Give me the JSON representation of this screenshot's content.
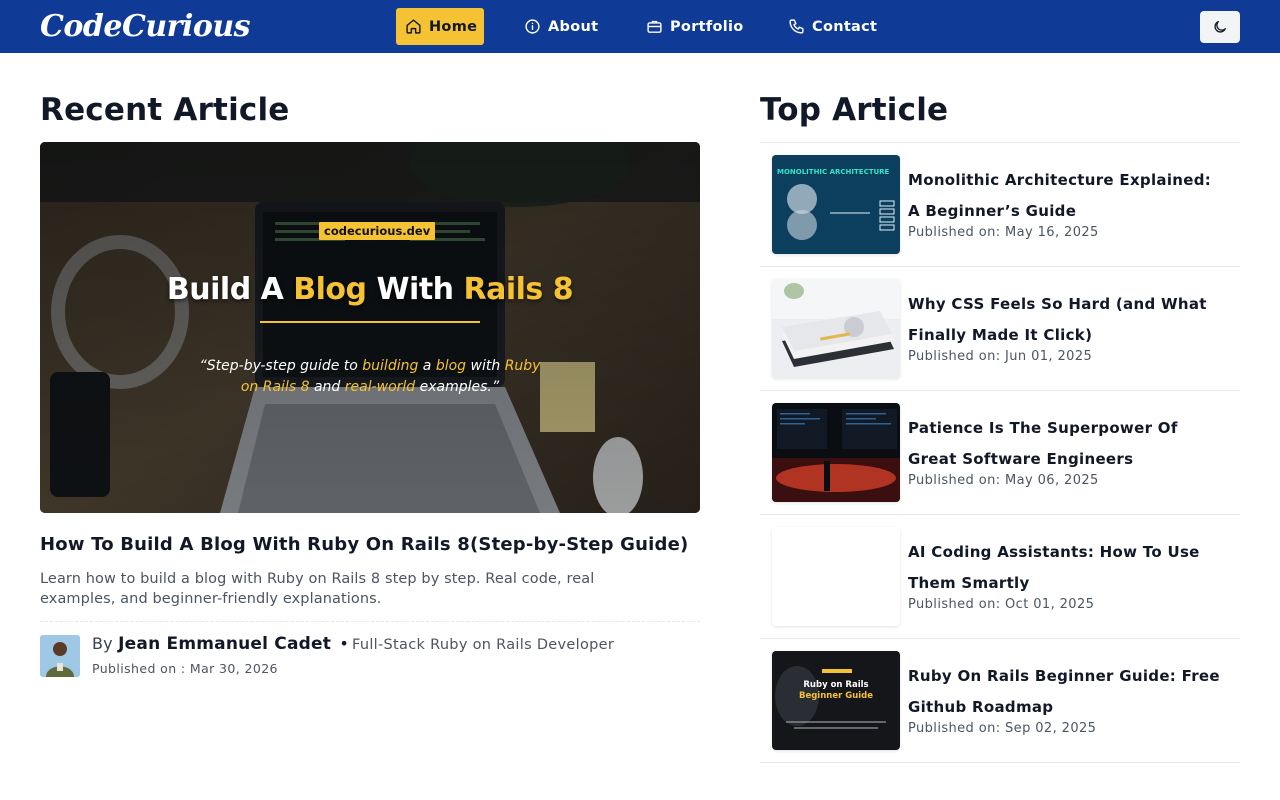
{
  "brand": "CodeCurious",
  "nav": {
    "items": [
      {
        "label": "Home",
        "icon": "home-icon"
      },
      {
        "label": "About",
        "icon": "info-icon"
      },
      {
        "label": "Portfolio",
        "icon": "briefcase-icon"
      },
      {
        "label": "Contact",
        "icon": "phone-icon"
      }
    ],
    "active": "Home",
    "theme_toggle_icon": "moon-icon"
  },
  "colors": {
    "navbar": "#0f3a96",
    "accent": "#f5c233",
    "text": "#111827",
    "muted": "#4b5563"
  },
  "recent": {
    "heading": "Recent Article",
    "image": {
      "site": "codecurious.dev",
      "headline_pre": "Build A ",
      "headline_hl1": "Blog",
      "headline_mid": " With ",
      "headline_hl2": "Rails 8",
      "sub_1": "“Step-by-step",
      "sub_2": " guide to ",
      "sub_3": "building",
      "sub_4": " a ",
      "sub_5": "blog",
      "sub_6": " with ",
      "sub_7": "Ruby on Rails 8",
      "sub_8": " and ",
      "sub_9": "real-world",
      "sub_10": " examples.”"
    },
    "title": "How To Build A Blog With Ruby On Rails 8(Step-by-Step Guide)",
    "description": "Learn how to build a blog with Ruby on Rails 8 step by step. Real code, real examples, and beginner-friendly explanations.",
    "author": {
      "prefix": "By",
      "name": "Jean Emmanuel Cadet",
      "separator": "•",
      "role": "Full-Stack Ruby on Rails Developer",
      "published": "Published on : Mar 30, 2026"
    }
  },
  "top": {
    "heading": "Top Article",
    "items": [
      {
        "title": "Monolithic Architecture Explained: A Beginner’s Guide",
        "date": "Published on: May 16, 2025",
        "thumb_text": "MONOLITHIC ARCHITECTURE"
      },
      {
        "title": "Why CSS Feels So Hard (and What Finally Made It Click)",
        "date": "Published on: Jun 01, 2025"
      },
      {
        "title": "Patience Is The Superpower Of Great Software Engineers",
        "date": "Published on: May 06, 2025"
      },
      {
        "title": "AI Coding Assistants: How To Use Them Smartly",
        "date": "Published on: Oct 01, 2025"
      },
      {
        "title": "Ruby On Rails Beginner Guide: Free Github Roadmap",
        "date": "Published on: Sep 02, 2025",
        "thumb_text_1": "Ruby on Rails",
        "thumb_text_2": "Beginner Guide"
      }
    ]
  }
}
